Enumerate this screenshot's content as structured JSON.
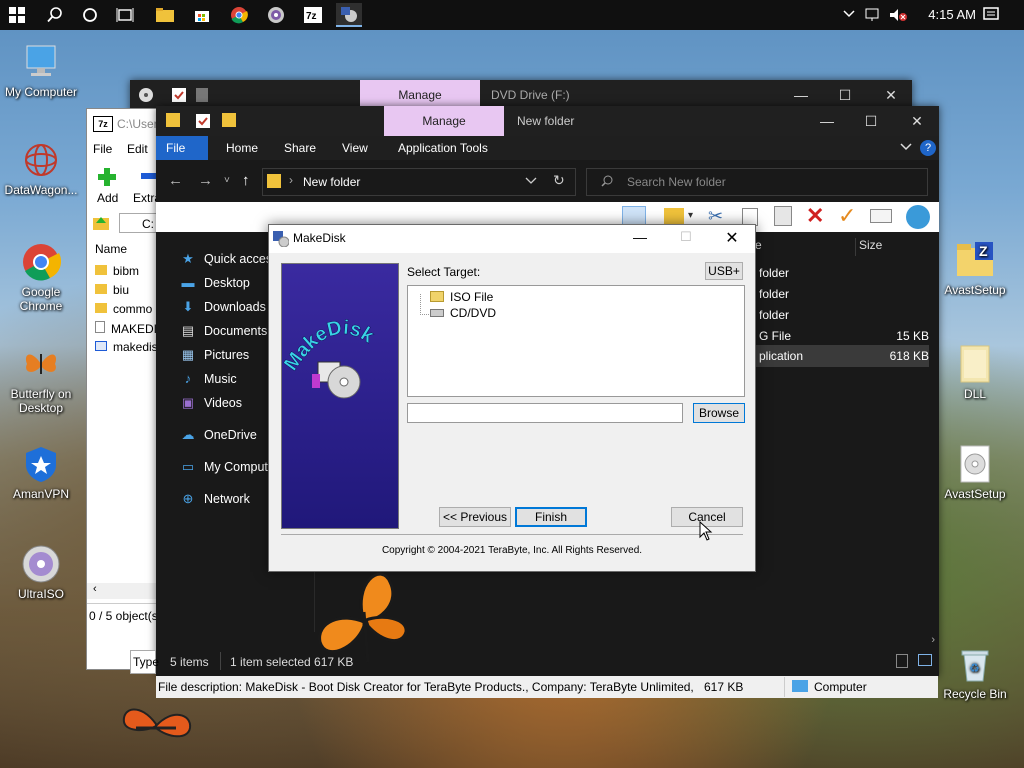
{
  "taskbar": {
    "clock": "4:15 AM",
    "icons": [
      "windows-icon",
      "search-icon",
      "cortana-icon",
      "task-view-icon",
      "file-explorer-icon",
      "store-icon",
      "chrome-icon",
      "media-icon",
      "7zip-icon",
      "makedisk-icon"
    ]
  },
  "desktop": {
    "icons": [
      {
        "label": "My Computer"
      },
      {
        "label": "DataWagon..."
      },
      {
        "label": "Google Chrome"
      },
      {
        "label": "Butterfly on Desktop"
      },
      {
        "label": "AmanVPN"
      },
      {
        "label": "UltraISO"
      },
      {
        "label": "AvastSetup"
      },
      {
        "label": "DLL"
      },
      {
        "label": "AvastSetup"
      },
      {
        "label": "Recycle Bin"
      }
    ]
  },
  "dvdwin": {
    "manage": "Manage",
    "title": "DVD Drive (F:)"
  },
  "explorer": {
    "manage": "Manage",
    "title": "New folder",
    "tabs": [
      "File",
      "Home",
      "Share",
      "View",
      "Application Tools"
    ],
    "address": "New folder",
    "search_placeholder": "Search New folder",
    "nav": [
      {
        "label": "Quick access"
      },
      {
        "label": "Desktop"
      },
      {
        "label": "Downloads"
      },
      {
        "label": "Documents"
      },
      {
        "label": "Pictures"
      },
      {
        "label": "Music"
      },
      {
        "label": "Videos"
      },
      {
        "label": "OneDrive"
      },
      {
        "label": "My Computer"
      },
      {
        "label": "Network"
      }
    ],
    "col_size": "Size",
    "rows": [
      {
        "type": "folder",
        "size": ""
      },
      {
        "type": "folder",
        "size": ""
      },
      {
        "type": "folder",
        "size": ""
      },
      {
        "type": "G File",
        "size": "15 KB"
      },
      {
        "type": "plication",
        "size": "618 KB"
      }
    ],
    "status": {
      "items": "5 items",
      "selected": "1 item selected  617 KB"
    }
  },
  "zipwin": {
    "path": "C:\\User",
    "menu": [
      "File",
      "Edit"
    ],
    "toolbar": [
      "Add",
      "Extra"
    ],
    "addr": "C:",
    "col_name": "Name",
    "files": [
      "bibm",
      "biu",
      "commo",
      "MAKEDIS",
      "makedis"
    ],
    "status": "0 / 5 object(s"
  },
  "dialog": {
    "title": "MakeDisk",
    "select_target": "Select Target:",
    "usb_btn": "USB+",
    "tree": [
      "ISO File",
      "CD/DVD"
    ],
    "browse": "Browse",
    "prev": "<< Previous",
    "finish": "Finish",
    "cancel": "Cancel",
    "logo_text": "MakeDisk",
    "copyright": "Copyright © 2004-2021 TeraByte, Inc.  All Rights Reserved."
  },
  "statusbar": {
    "description": "File description: MakeDisk - Boot Disk Creator for TeraByte Products., Company: TeraByte Unlimited, File",
    "size": "617 KB",
    "location": "Computer"
  }
}
